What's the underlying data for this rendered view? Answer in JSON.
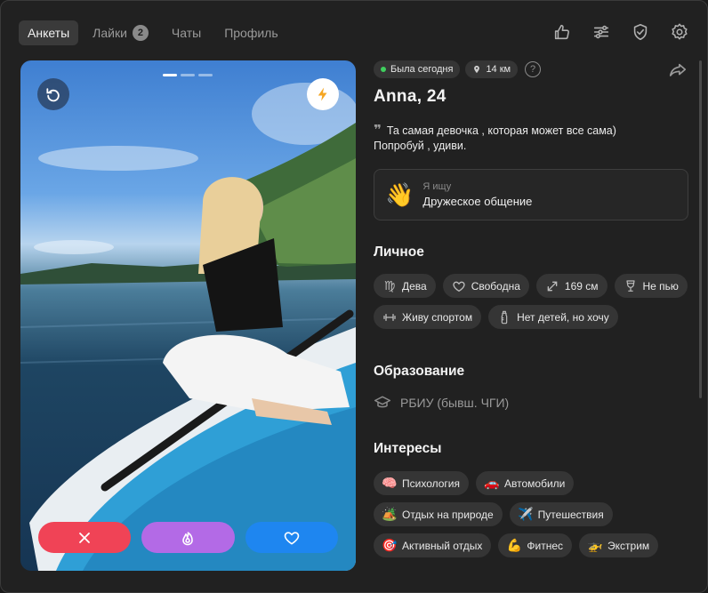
{
  "nav": {
    "tabs": [
      {
        "label": "Анкеты",
        "active": true
      },
      {
        "label": "Лайки",
        "badge": "2"
      },
      {
        "label": "Чаты"
      },
      {
        "label": "Профиль"
      }
    ],
    "icons": [
      "thumbs-up-icon",
      "sliders-icon",
      "shield-check-icon",
      "gear-icon"
    ]
  },
  "card": {
    "pager_count": 3,
    "pager_active": 0,
    "undo_icon": "undo-icon",
    "boost_icon": "lightning-icon",
    "actions": [
      "close-icon",
      "fire-icon",
      "heart-icon"
    ]
  },
  "profile": {
    "status": "Была сегодня",
    "distance": "14 км",
    "help": "?",
    "name": "Anna, 24",
    "bio_line1": "Та самая девочка , которая может все сама)",
    "bio_line2": "Попробуй , удиви.",
    "seek_emoji": "👋",
    "seek_label": "Я ищу",
    "seek_value": "Дружеское общение"
  },
  "personal": {
    "title": "Личное",
    "zodiac": "Дева",
    "relationship": "Свободна",
    "height": "169 см",
    "drinking": "Не пью",
    "sport": "Живу спортом",
    "kids": "Нет детей, но хочу"
  },
  "education": {
    "title": "Образование",
    "value": "РБИУ (бывш. ЧГИ)"
  },
  "interests": {
    "title": "Интересы",
    "items": [
      {
        "emoji": "🧠",
        "label": "Психология"
      },
      {
        "emoji": "🚗",
        "label": "Автомобили"
      },
      {
        "emoji": "🏕️",
        "label": "Отдых на природе"
      },
      {
        "emoji": "✈️",
        "label": "Путешествия"
      },
      {
        "emoji": "🎯",
        "label": "Активный отдых"
      },
      {
        "emoji": "💪",
        "label": "Фитнес"
      },
      {
        "emoji": "🚁",
        "label": "Экстрим"
      }
    ]
  },
  "colors": {
    "dislike": "#f04356",
    "super": "#b36ae6",
    "like": "#1e86f0",
    "online": "#3fcf5e"
  }
}
